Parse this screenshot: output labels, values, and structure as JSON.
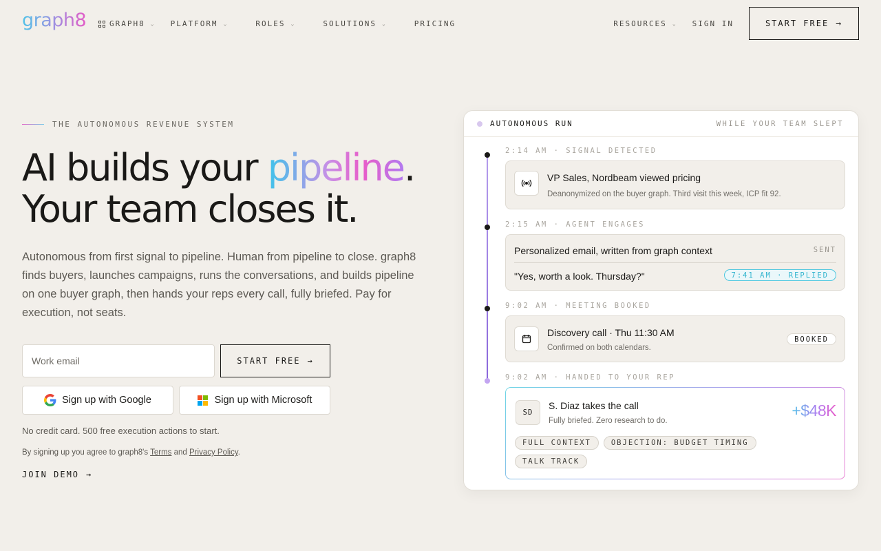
{
  "nav": {
    "logo": "graph8",
    "items": [
      {
        "label": "GRAPH8"
      },
      {
        "label": "PLATFORM"
      },
      {
        "label": "ROLES"
      },
      {
        "label": "SOLUTIONS"
      },
      {
        "label": "PRICING"
      }
    ],
    "resources": "RESOURCES",
    "sign_in": "SIGN IN",
    "start_free": "START FREE"
  },
  "hero": {
    "eyebrow": "THE AUTONOMOUS REVENUE SYSTEM",
    "headline_a": "AI builds your ",
    "headline_grad": "pipeline",
    "headline_b": ".",
    "headline_c": "Your team closes it.",
    "sub": "Autonomous from first signal to pipeline. Human from pipeline to close. graph8 finds buyers, launches campaigns, runs the conversations, and builds pipeline on one buyer graph, then hands your reps every call, fully briefed. Pay for execution, not seats.",
    "email_placeholder": "Work email",
    "start_free": "START FREE",
    "google": "Sign up with Google",
    "microsoft": "Sign up with Microsoft",
    "note1": "No credit card. 500 free execution actions to start.",
    "note2_pre": "By signing up you agree to graph8's ",
    "terms": "Terms",
    "and": " and ",
    "privacy": "Privacy Policy",
    "note2_post": ".",
    "join_demo": "JOIN DEMO"
  },
  "panel": {
    "title": "AUTONOMOUS RUN",
    "right": "WHILE YOUR TEAM SLEPT",
    "steps": [
      {
        "label": "2:14 AM · SIGNAL DETECTED",
        "title": "VP Sales, Nordbeam viewed pricing",
        "sub": "Deanonymized on the buyer graph. Third visit this week, ICP fit 92."
      },
      {
        "label": "2:15 AM · AGENT ENGAGES",
        "title": "Personalized email, written from graph context",
        "status": "SENT",
        "reply": "\"Yes, worth a look. Thursday?\"",
        "reply_badge": "7:41 AM · REPLIED"
      },
      {
        "label": "9:02 AM · MEETING BOOKED",
        "title": "Discovery call · Thu 11:30 AM",
        "sub": "Confirmed on both calendars.",
        "badge": "BOOKED"
      },
      {
        "label": "9:02 AM · HANDED TO YOUR REP",
        "initials": "SD",
        "title": "S. Diaz takes the call",
        "sub": "Fully briefed. Zero research to do.",
        "amount": "+$48K",
        "chips": [
          "FULL CONTEXT",
          "OBJECTION: BUDGET TIMING",
          "TALK TRACK"
        ]
      }
    ]
  }
}
